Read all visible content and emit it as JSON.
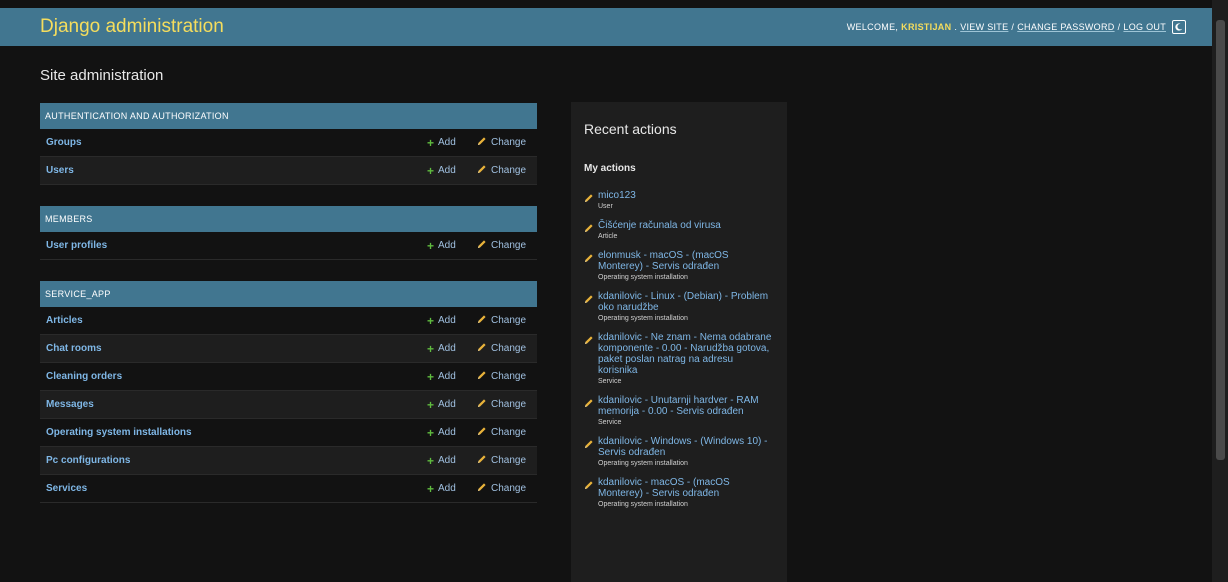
{
  "header": {
    "brand": "Django administration",
    "welcome": "WELCOME,",
    "username": "KRISTIJAN",
    "view_site": "VIEW SITE",
    "change_password": "CHANGE PASSWORD",
    "logout": "LOG OUT",
    "separator": "/"
  },
  "page_title": "Site administration",
  "modules": [
    {
      "caption": "AUTHENTICATION AND AUTHORIZATION",
      "models": [
        "Groups",
        "Users"
      ]
    },
    {
      "caption": "MEMBERS",
      "models": [
        "User profiles"
      ]
    },
    {
      "caption": "SERVICE_APP",
      "models": [
        "Articles",
        "Chat rooms",
        "Cleaning orders",
        "Messages",
        "Operating system installations",
        "Pc configurations",
        "Services"
      ]
    }
  ],
  "labels": {
    "add": "Add",
    "change": "Change"
  },
  "recent": {
    "title": "Recent actions",
    "subtitle": "My actions",
    "items": [
      {
        "title": "mico123",
        "type": "User"
      },
      {
        "title": "Čišćenje računala od virusa",
        "type": "Article"
      },
      {
        "title": "elonmusk - macOS - (macOS Monterey) - Servis odrađen",
        "type": "Operating system installation"
      },
      {
        "title": "kdanilovic - Linux - (Debian) - Problem oko narudžbe",
        "type": "Operating system installation"
      },
      {
        "title": "kdanilovic - Ne znam - Nema odabrane komponente - 0.00 - Narudžba gotova, paket poslan natrag na adresu korisnika",
        "type": "Service"
      },
      {
        "title": "kdanilovic - Unutarnji hardver - RAM memorija - 0.00 - Servis odrađen",
        "type": "Service"
      },
      {
        "title": "kdanilovic - Windows - (Windows 10) - Servis odrađen",
        "type": "Operating system installation"
      },
      {
        "title": "kdanilovic - macOS - (macOS Monterey) - Servis odrađen",
        "type": "Operating system installation"
      }
    ]
  },
  "colors": {
    "header_bg": "#417690",
    "brand": "#f5dd5d",
    "link": "#7fb7e6",
    "add_plus": "#5fba3f",
    "pencil": "#e8b23a",
    "body_bg": "#121212"
  },
  "icons": {
    "add": "plus-icon",
    "change": "pencil-icon",
    "theme": "theme-toggle-icon"
  }
}
